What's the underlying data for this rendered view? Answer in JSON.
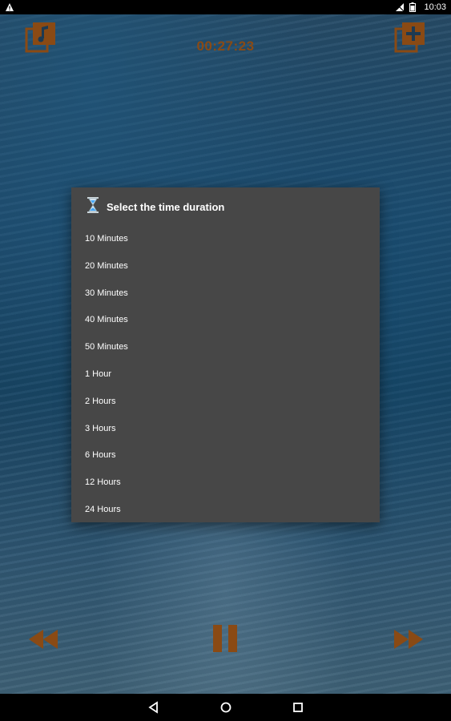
{
  "status": {
    "time": "10:03",
    "alert_icon": "warning-icon",
    "signal_icon": "no-signal-icon",
    "battery_icon": "battery-icon"
  },
  "player": {
    "timer": "00:27:23",
    "playlist_icon": "music-library-icon",
    "add_icon": "add-to-library-icon",
    "accent_color": "#8a4a14"
  },
  "dialog": {
    "title": "Select the time duration",
    "title_icon": "hourglass-icon",
    "options": [
      "10 Minutes",
      "20 Minutes",
      "30 Minutes",
      "40 Minutes",
      "50 Minutes",
      "1 Hour",
      "2 Hours",
      "3 Hours",
      "6 Hours",
      "12 Hours",
      "24 Hours"
    ]
  },
  "controls": {
    "rewind_icon": "rewind-icon",
    "pause_icon": "pause-icon",
    "forward_icon": "fast-forward-icon"
  },
  "nav": {
    "back_icon": "back-icon",
    "home_icon": "home-icon",
    "recents_icon": "recents-icon"
  }
}
